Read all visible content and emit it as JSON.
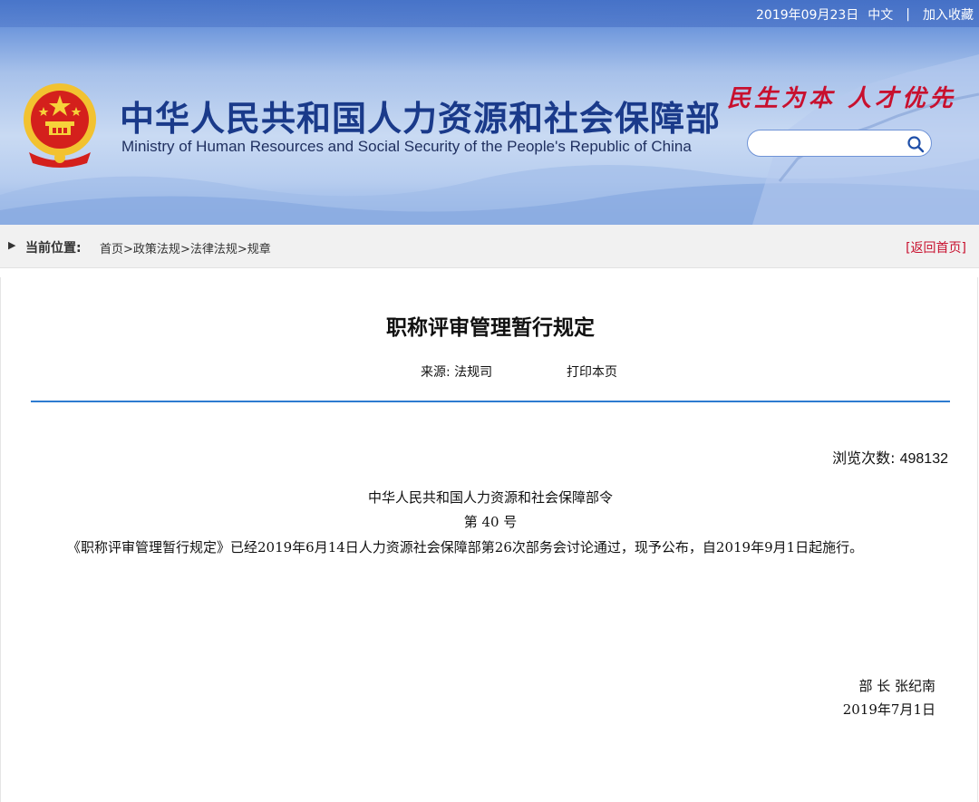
{
  "top_bar": {
    "date": "2019年09月23日",
    "lang": "中文",
    "separator": "|",
    "favorite": "加入收藏"
  },
  "header": {
    "title_cn": "中华人民共和国人力资源和社会保障部",
    "title_en": "Ministry of Human Resources and Social Security of the People's Republic of China",
    "slogan": "民生为本 人才优先",
    "search_placeholder": "",
    "emblem_icon": "national-emblem",
    "search_icon": "search-icon"
  },
  "breadcrumb": {
    "label": "当前位置:",
    "items": [
      "首页",
      "政策法规",
      "法律法规",
      "规章"
    ],
    "separator": ">",
    "home_link": "[返回首页]"
  },
  "article": {
    "title": "职称评审管理暂行规定",
    "source": "来源: 法规司",
    "print": "打印本页",
    "views_label": "浏览次数:",
    "views": "498132",
    "decree_title": "中华人民共和国人力资源和社会保障部令",
    "decree_no": "第 40 号",
    "paragraph": "《职称评审管理暂行规定》已经2019年6月14日人力资源社会保障部第26次部务会讨论通过，现予公布，自2019年9月1日起施行。",
    "signer": "部 长 张纪南",
    "sign_date": "2019年7月1日"
  },
  "colors": {
    "title_blue": "#1a3a8a",
    "slogan_red": "#c8102e",
    "divider_blue": "#2d7bd0",
    "home_link_red": "#c8102e"
  }
}
